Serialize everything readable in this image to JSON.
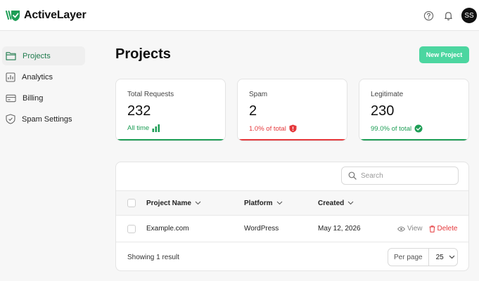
{
  "app": {
    "name": "ActiveLayer"
  },
  "header": {
    "avatar_initials": "SS",
    "icons": [
      "help-icon",
      "bell-icon"
    ]
  },
  "sidebar": {
    "items": [
      {
        "label": "Projects",
        "icon": "folder-icon",
        "active": true
      },
      {
        "label": "Analytics",
        "icon": "bar-chart-icon",
        "active": false
      },
      {
        "label": "Billing",
        "icon": "credit-card-icon",
        "active": false
      },
      {
        "label": "Spam Settings",
        "icon": "shield-icon",
        "active": false
      }
    ]
  },
  "page": {
    "title": "Projects",
    "new_button": "New Project"
  },
  "stats": [
    {
      "label": "Total Requests",
      "value": "232",
      "sub": "All time",
      "color": "#1e9e56",
      "icon": "bars-icon"
    },
    {
      "label": "Spam",
      "value": "2",
      "sub": "1.0% of total",
      "color": "#e5383b",
      "icon": "alert-shield-icon"
    },
    {
      "label": "Legitimate",
      "value": "230",
      "sub": "99.0% of total",
      "color": "#1e9e56",
      "icon": "check-circle-icon"
    }
  ],
  "table": {
    "search_placeholder": "Search",
    "columns": [
      "Project Name",
      "Platform",
      "Created"
    ],
    "rows": [
      {
        "name": "Example.com",
        "platform": "WordPress",
        "created": "May 12, 2026",
        "view": "View",
        "delete": "Delete"
      }
    ],
    "footer": "Showing 1 result",
    "per_page_label": "Per page",
    "per_page_value": "25"
  },
  "colors": {
    "accent": "#4cd6a0",
    "brand_green": "#1e7a4c",
    "danger": "#e5383b"
  }
}
